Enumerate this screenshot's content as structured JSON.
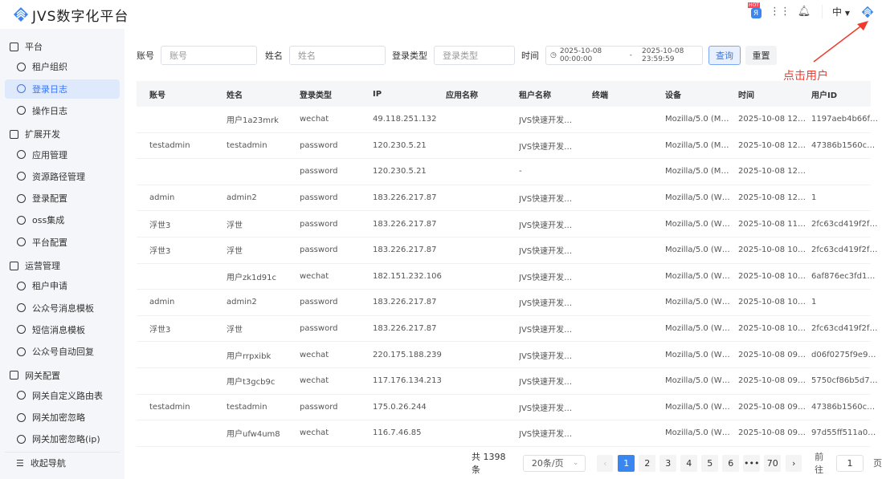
{
  "header": {
    "title": "JVS数字化平台",
    "lang": "中",
    "hot_badge": "HOT"
  },
  "annotation": "点击用户",
  "sidebar": {
    "groups": [
      {
        "label": "平台",
        "items": [
          {
            "label": "租户组织"
          },
          {
            "label": "登录日志",
            "active": true
          },
          {
            "label": "操作日志"
          }
        ]
      },
      {
        "label": "扩展开发",
        "items": [
          {
            "label": "应用管理"
          },
          {
            "label": "资源路径管理"
          },
          {
            "label": "登录配置"
          },
          {
            "label": "oss集成"
          },
          {
            "label": "平台配置"
          }
        ]
      },
      {
        "label": "运营管理",
        "items": [
          {
            "label": "租户申请"
          },
          {
            "label": "公众号消息模板"
          },
          {
            "label": "短信消息模板"
          },
          {
            "label": "公众号自动回复"
          }
        ]
      },
      {
        "label": "网关配置",
        "items": [
          {
            "label": "网关自定义路由表"
          },
          {
            "label": "网关加密忽略"
          },
          {
            "label": "网关加密忽略(ip)"
          }
        ]
      }
    ],
    "collapse": "收起导航"
  },
  "filters": {
    "account_label": "账号",
    "account_placeholder": "账号",
    "name_label": "姓名",
    "name_placeholder": "姓名",
    "type_label": "登录类型",
    "type_placeholder": "登录类型",
    "time_label": "时间",
    "time_start": "2025-10-08 00:00:00",
    "time_sep": "-",
    "time_end": "2025-10-08 23:59:59",
    "query": "查询",
    "reset": "重置"
  },
  "table": {
    "columns": [
      "账号",
      "姓名",
      "登录类型",
      "IP",
      "应用名称",
      "租户名称",
      "终端",
      "设备",
      "时间",
      "用户ID"
    ],
    "rows": [
      [
        "",
        "用户1a23mrk",
        "wechat",
        "49.118.251.132",
        "",
        "JVS快速开发…",
        "",
        "Mozilla/5.0 (M…",
        "2025-10-08 12…",
        "1197aeb4b66f…"
      ],
      [
        "testadmin",
        "testadmin",
        "password",
        "120.230.5.21",
        "",
        "JVS快速开发…",
        "",
        "Mozilla/5.0 (M…",
        "2025-10-08 12…",
        "47386b1560c…"
      ],
      [
        "",
        "",
        "password",
        "120.230.5.21",
        "",
        "-",
        "",
        "Mozilla/5.0 (M…",
        "2025-10-08 12…",
        ""
      ],
      [
        "admin",
        "admin2",
        "password",
        "183.226.217.87",
        "",
        "JVS快速开发…",
        "",
        "Mozilla/5.0 (W…",
        "2025-10-08 12…",
        "1"
      ],
      [
        "浮世3",
        "浮世",
        "password",
        "183.226.217.87",
        "",
        "JVS快速开发…",
        "",
        "Mozilla/5.0 (W…",
        "2025-10-08 11…",
        "2fc63cd419f2f…"
      ],
      [
        "浮世3",
        "浮世",
        "password",
        "183.226.217.87",
        "",
        "JVS快速开发…",
        "",
        "Mozilla/5.0 (W…",
        "2025-10-08 10…",
        "2fc63cd419f2f…"
      ],
      [
        "",
        "用户zk1d91c",
        "wechat",
        "182.151.232.106",
        "",
        "JVS快速开发…",
        "",
        "Mozilla/5.0 (W…",
        "2025-10-08 10…",
        "6af876ec3fd1…"
      ],
      [
        "admin",
        "admin2",
        "password",
        "183.226.217.87",
        "",
        "JVS快速开发…",
        "",
        "Mozilla/5.0 (W…",
        "2025-10-08 10…",
        "1"
      ],
      [
        "浮世3",
        "浮世",
        "password",
        "183.226.217.87",
        "",
        "JVS快速开发…",
        "",
        "Mozilla/5.0 (W…",
        "2025-10-08 10…",
        "2fc63cd419f2f…"
      ],
      [
        "",
        "用户rrpxibk",
        "wechat",
        "220.175.188.239",
        "",
        "JVS快速开发…",
        "",
        "Mozilla/5.0 (W…",
        "2025-10-08 09…",
        "d06f0275f9e9…"
      ],
      [
        "",
        "用户t3gcb9c",
        "wechat",
        "117.176.134.213",
        "",
        "JVS快速开发…",
        "",
        "Mozilla/5.0 (W…",
        "2025-10-08 09…",
        "5750cf86b5d7…"
      ],
      [
        "testadmin",
        "testadmin",
        "password",
        "175.0.26.244",
        "",
        "JVS快速开发…",
        "",
        "Mozilla/5.0 (W…",
        "2025-10-08 09…",
        "47386b1560c…"
      ],
      [
        "",
        "用户ufw4um8",
        "wechat",
        "116.7.46.85",
        "",
        "JVS快速开发…",
        "",
        "Mozilla/5.0 (W…",
        "2025-10-08 09…",
        "97d55ff511a0…"
      ]
    ]
  },
  "pagination": {
    "total": "共 1398 条",
    "page_size": "20条/页",
    "pages": [
      "1",
      "2",
      "3",
      "4",
      "5",
      "6",
      "•••",
      "70"
    ],
    "current": "1",
    "goto_label": "前往",
    "goto_value": "1",
    "goto_suffix": "页",
    "prev": "‹",
    "next": "›"
  }
}
